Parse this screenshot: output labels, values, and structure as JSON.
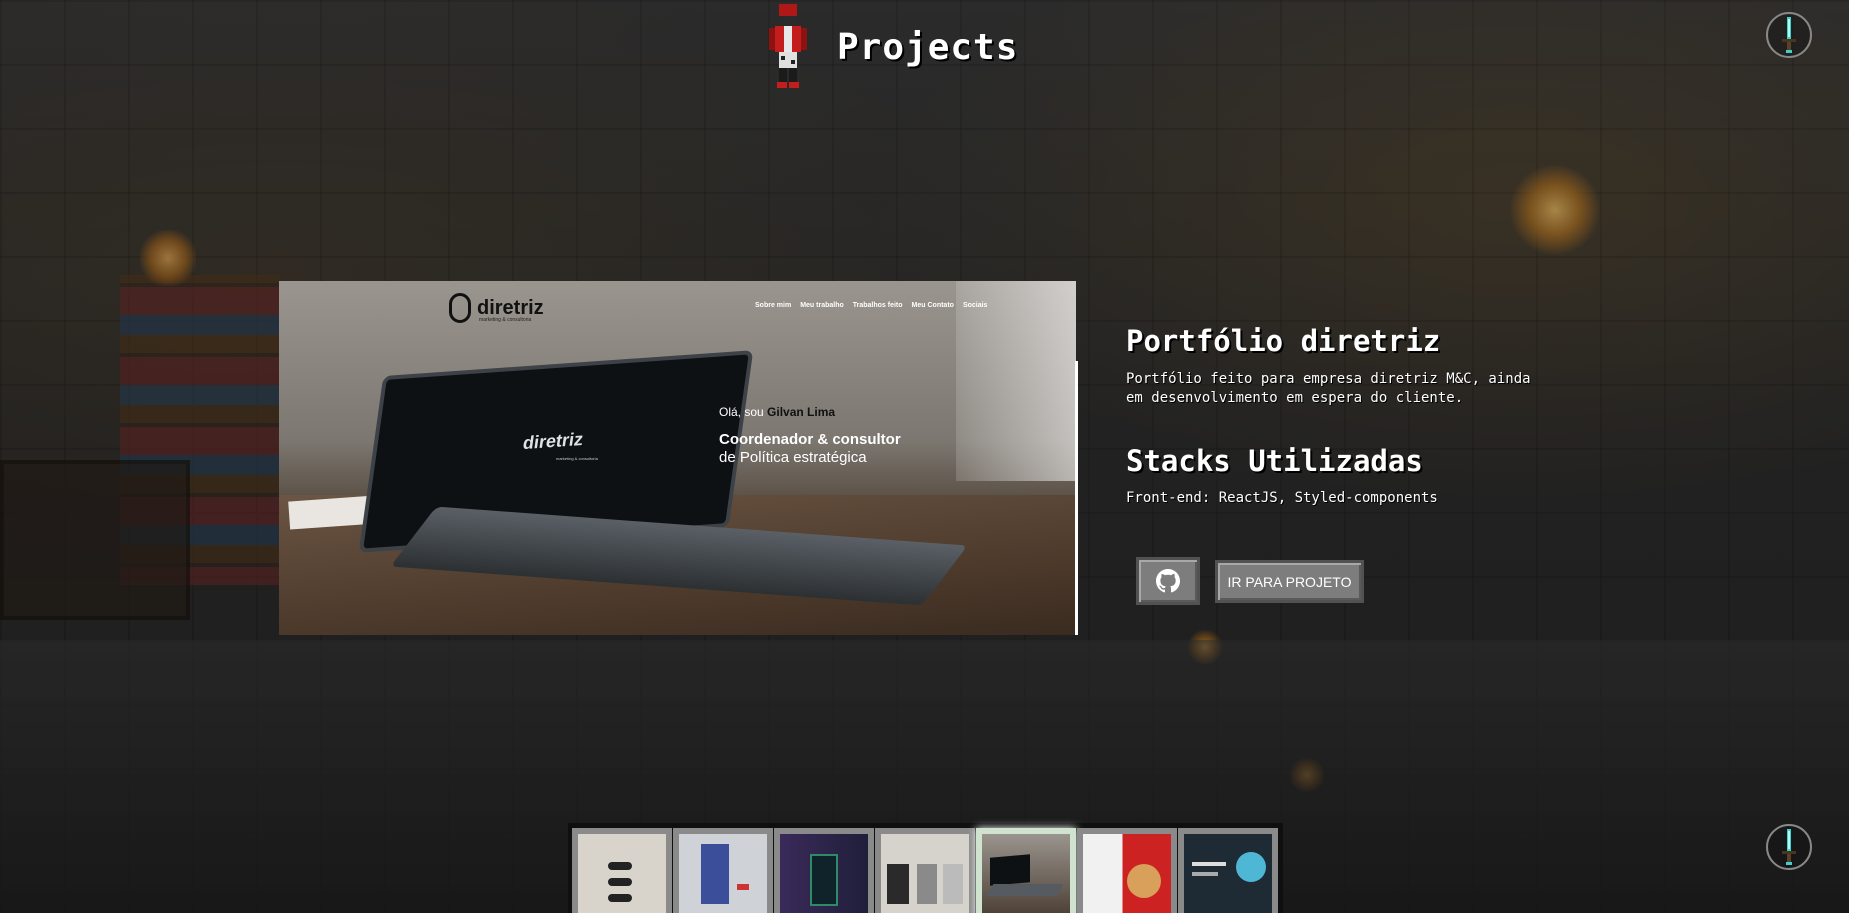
{
  "header": {
    "title": "Projects"
  },
  "project": {
    "title": "Portfólio diretriz",
    "description": "Portfólio feito para empresa diretriz M&C, ainda em desenvolvimento em espera do cliente.",
    "stacks_heading": "Stacks Utilizadas",
    "stacks": "Front-end: ReactJS, Styled-components"
  },
  "buttons": {
    "github_icon": "github-icon",
    "go_to_project": "IR PARA PROJETO"
  },
  "preview": {
    "logo": "diretriz",
    "logo_sub": "marketing & consultoria",
    "nav": [
      "Sobre mim",
      "Meu trabalho",
      "Trabalhos feito",
      "Meu Contato",
      "Sociais"
    ],
    "hello_prefix": "Olá, sou",
    "hello_name": "Gilvan Lima",
    "role_line1": "Coordenador & consultor",
    "role_line2": "de Política estratégica",
    "screen_logo": "diretriz"
  },
  "thumbnails": {
    "count": 7,
    "active_index": 4
  },
  "colors": {
    "accent_sword": "#3fd1c9",
    "button_gray": "#7d7d7d"
  }
}
